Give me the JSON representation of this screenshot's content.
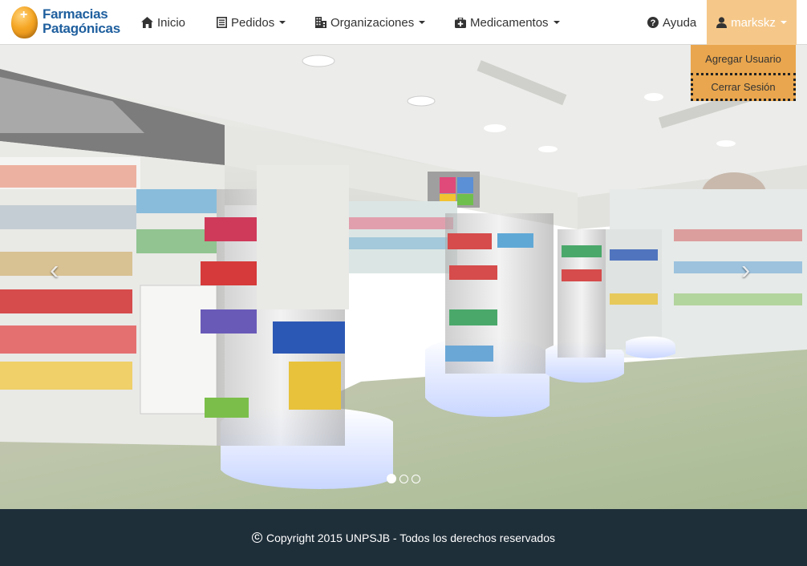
{
  "brand": {
    "line1": "Farmacias",
    "line2": "Patagónicas",
    "logo_icon": "pharmacy-egg-logo"
  },
  "nav": {
    "home": {
      "label": "Inicio",
      "icon": "home-icon"
    },
    "orders": {
      "label": "Pedidos",
      "icon": "list-icon"
    },
    "organizations": {
      "label": "Organizaciones",
      "icon": "building-icon"
    },
    "medicines": {
      "label": "Medicamentos",
      "icon": "medkit-icon"
    },
    "help": {
      "label": "Ayuda",
      "icon": "question-circle-icon"
    },
    "user": {
      "label": "markskz",
      "icon": "user-icon"
    }
  },
  "user_menu": {
    "items": [
      "Agregar Usuario",
      "Cerrar Sesión"
    ]
  },
  "carousel": {
    "prev_icon": "chevron-left-icon",
    "next_icon": "chevron-right-icon",
    "slide_count": 3,
    "active_index": 0,
    "image": "pharmacy-interior-photo"
  },
  "footer": {
    "text": "Copyright 2015 UNPSJB - Todos los derechos reservados",
    "icon": "copyright-icon"
  },
  "colors": {
    "brand_blue": "#1f5f9e",
    "user_tab": "#f5c88a",
    "dropdown_bg": "#e9a64e",
    "footer_bg": "#1f2f3a"
  }
}
